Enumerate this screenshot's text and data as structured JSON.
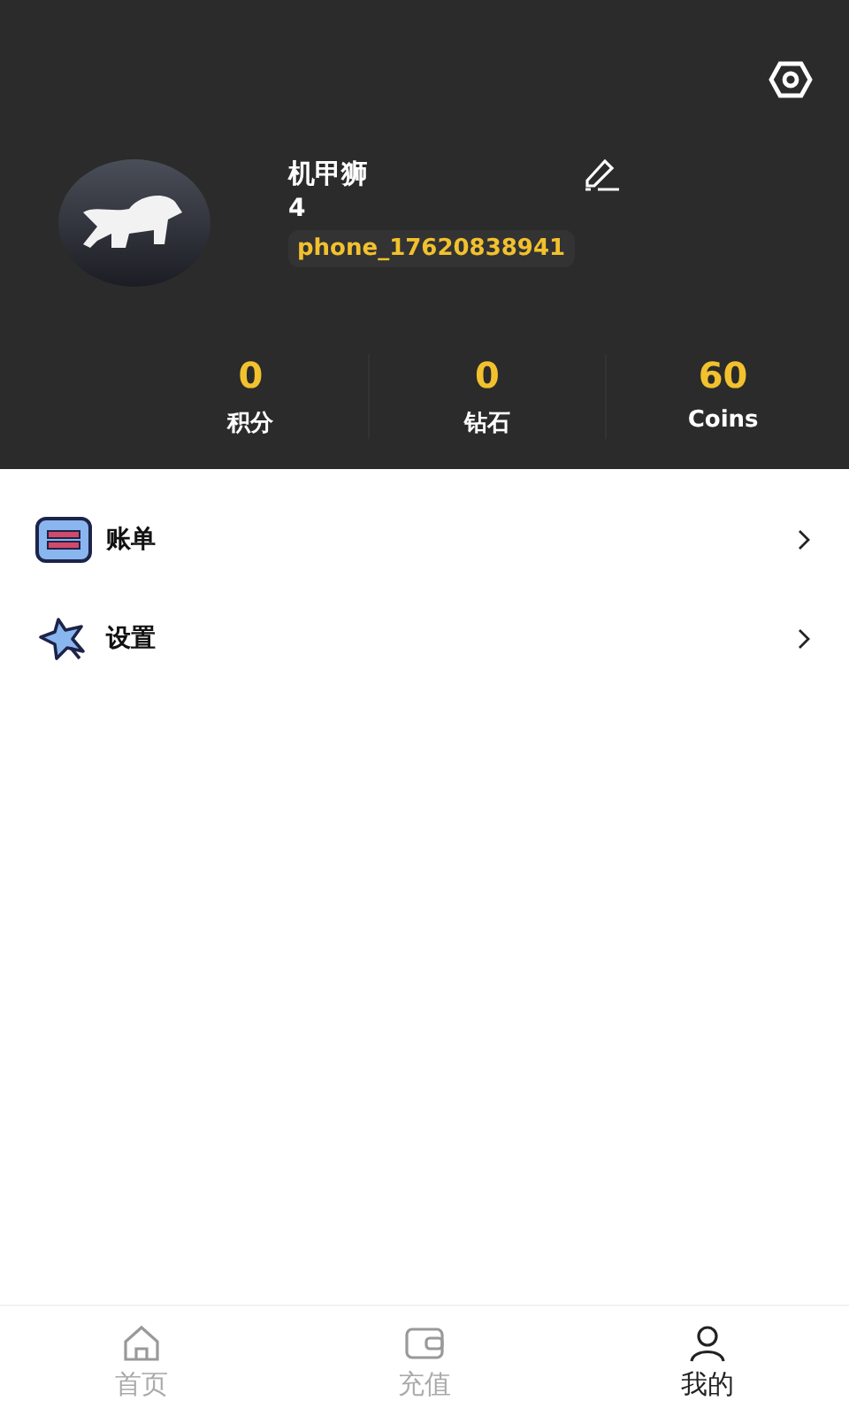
{
  "profile": {
    "name": "机甲狮",
    "level": "4",
    "account": "phone_17620838941"
  },
  "stats": [
    {
      "value": "0",
      "label": "积分"
    },
    {
      "value": "0",
      "label": "钻石"
    },
    {
      "value": "60",
      "label": "Coins"
    }
  ],
  "menu": [
    {
      "kind": "bill",
      "label": "账单"
    },
    {
      "kind": "settings",
      "label": "设置"
    }
  ],
  "tabs": [
    {
      "kind": "home",
      "label": "首页",
      "selected": false
    },
    {
      "kind": "wallet",
      "label": "充值",
      "selected": false
    },
    {
      "kind": "user",
      "label": "我的",
      "selected": true
    }
  ]
}
